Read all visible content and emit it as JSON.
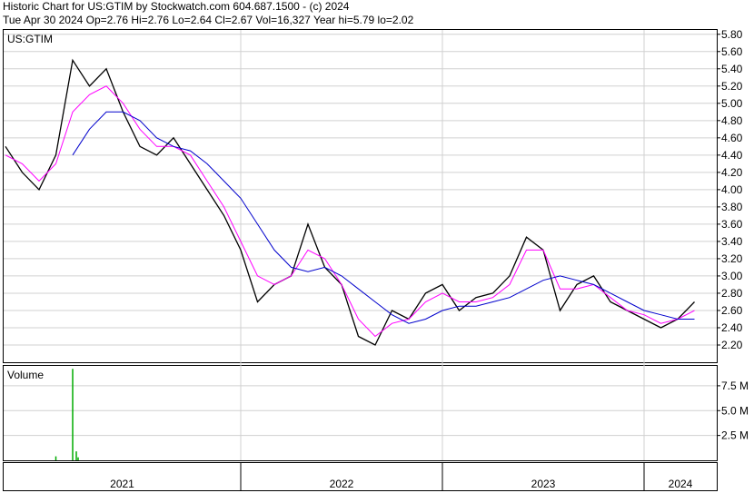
{
  "header": {
    "line1": "Historic Chart for US:GTIM by Stockwatch.com 604.687.1500 - (c) 2024",
    "line2": "Tue Apr 30 2024  Op=2.76  Hi=2.76  Lo=2.64  Cl=2.67  Vol=16,327  Year hi=5.79  lo=2.02"
  },
  "chart_data": {
    "type": "line",
    "symbol_label": "US:GTIM",
    "volume_label": "Volume",
    "price_ticks": [
      "5.80",
      "5.60",
      "5.40",
      "5.20",
      "5.00",
      "4.80",
      "4.60",
      "4.40",
      "4.20",
      "4.00",
      "3.80",
      "3.60",
      "3.40",
      "3.20",
      "3.00",
      "2.80",
      "2.60",
      "2.40",
      "2.20"
    ],
    "volume_ticks": [
      "7.5 M",
      "5.0 M",
      "2.5 M"
    ],
    "year_labels": [
      "2021",
      "2022",
      "2023",
      "2024"
    ],
    "price_range": [
      2.0,
      5.85
    ],
    "volume_range": [
      0,
      9.5
    ],
    "grid": true,
    "colors": {
      "price": "#000000",
      "ma_short": "#ff00ff",
      "ma_long": "#0000cc",
      "volume": "#00aa00"
    },
    "series": [
      {
        "name": "price",
        "x": [
          "2020-11",
          "2020-12",
          "2021-01",
          "2021-02",
          "2021-03",
          "2021-04",
          "2021-05",
          "2021-06",
          "2021-07",
          "2021-08",
          "2021-09",
          "2021-10",
          "2021-11",
          "2021-12",
          "2022-01",
          "2022-02",
          "2022-03",
          "2022-04",
          "2022-05",
          "2022-06",
          "2022-07",
          "2022-08",
          "2022-09",
          "2022-10",
          "2022-11",
          "2022-12",
          "2023-01",
          "2023-02",
          "2023-03",
          "2023-04",
          "2023-05",
          "2023-06",
          "2023-07",
          "2023-08",
          "2023-09",
          "2023-10",
          "2023-11",
          "2023-12",
          "2024-01",
          "2024-02",
          "2024-03",
          "2024-04"
        ],
        "values": [
          4.5,
          4.2,
          4.0,
          4.4,
          5.5,
          5.2,
          5.4,
          4.9,
          4.5,
          4.4,
          4.6,
          4.3,
          4.0,
          3.7,
          3.3,
          2.7,
          2.9,
          3.0,
          3.6,
          3.1,
          2.9,
          2.3,
          2.2,
          2.6,
          2.5,
          2.8,
          2.9,
          2.6,
          2.75,
          2.8,
          3.0,
          3.45,
          3.3,
          2.6,
          2.9,
          3.0,
          2.7,
          2.6,
          2.5,
          2.4,
          2.5,
          2.7
        ]
      },
      {
        "name": "ma_short",
        "values": [
          4.4,
          4.3,
          4.1,
          4.3,
          4.9,
          5.1,
          5.2,
          5.0,
          4.7,
          4.5,
          4.5,
          4.4,
          4.1,
          3.8,
          3.4,
          3.0,
          2.9,
          3.0,
          3.3,
          3.2,
          2.9,
          2.5,
          2.3,
          2.45,
          2.5,
          2.7,
          2.8,
          2.7,
          2.7,
          2.75,
          2.9,
          3.3,
          3.3,
          2.85,
          2.85,
          2.9,
          2.75,
          2.6,
          2.55,
          2.45,
          2.5,
          2.6
        ]
      },
      {
        "name": "ma_long",
        "values": [
          null,
          null,
          null,
          null,
          4.4,
          4.7,
          4.9,
          4.9,
          4.8,
          4.6,
          4.5,
          4.45,
          4.3,
          4.1,
          3.9,
          3.6,
          3.3,
          3.1,
          3.05,
          3.1,
          3.0,
          2.85,
          2.7,
          2.55,
          2.45,
          2.5,
          2.6,
          2.65,
          2.65,
          2.7,
          2.75,
          2.85,
          2.95,
          3.0,
          2.95,
          2.9,
          2.8,
          2.7,
          2.6,
          2.55,
          2.5,
          2.5
        ]
      }
    ],
    "volume": {
      "name": "Volume",
      "x": [
        "2021-02",
        "2021-03",
        "2021-03",
        "2021-03"
      ],
      "values": [
        0.4,
        9.2,
        0.9,
        0.3
      ]
    }
  }
}
